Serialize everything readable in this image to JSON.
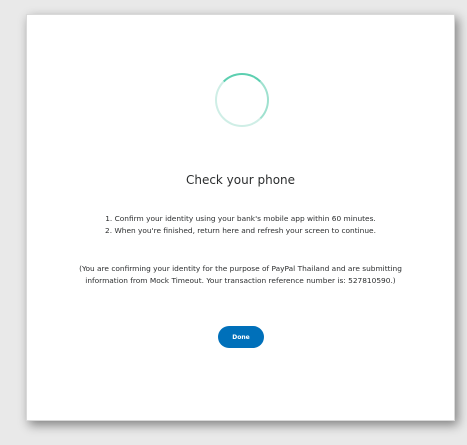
{
  "dialog": {
    "title": "Check your phone",
    "steps": [
      "1. Confirm your identity using your bank's mobile app within 60 minutes.",
      "2. When you're finished, return here and refresh your screen to continue."
    ],
    "note": "(You are confirming your identity for the purpose of PayPal Thailand and are submitting information from Mock Timeout. Your transaction reference number is: 527810590.)",
    "done_label": "Done",
    "spinner_icon": "loading-spinner-icon"
  },
  "colors": {
    "accent": "#0070ba",
    "spinner": "#5ccfb0"
  }
}
